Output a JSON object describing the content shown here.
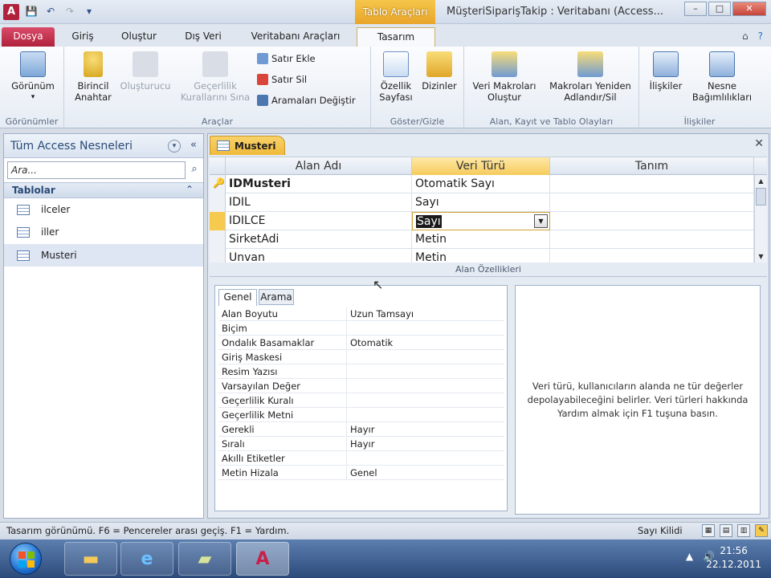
{
  "window": {
    "app_icon": "A",
    "title": "MüşteriSiparişTakip : Veritabanı (Access...",
    "context_tab_title": "Tablo Araçları",
    "controls": [
      "–",
      "□",
      "✕"
    ]
  },
  "qat": [
    "save-icon",
    "undo-icon",
    "redo-icon",
    "customize-icon"
  ],
  "tabs": {
    "file": "Dosya",
    "items": [
      "Giriş",
      "Oluştur",
      "Dış Veri",
      "Veritabanı Araçları",
      "Tasarım"
    ],
    "active": "Tasarım"
  },
  "ribbon": {
    "groups": {
      "gorunumler": "Görünümler",
      "araclar": "Araçlar",
      "goster_gizle": "Göster/Gizle",
      "olaylar": "Alan, Kayıt ve Tablo Olayları",
      "iliskiler": "İlişkiler"
    },
    "buttons": {
      "gorunum": "Görünüm",
      "birincil_anahtar": "Birincil Anahtar",
      "olusturucu": "Oluşturucu",
      "gecerlilik": "Geçerlilik Kurallarını Sına",
      "satir_ekle": "Satır Ekle",
      "satir_sil": "Satır Sil",
      "aramalari_degistir": "Aramaları Değiştir",
      "ozellik_sayfasi": "Özellik Sayfası",
      "dizinler": "Dizinler",
      "veri_makrolari": "Veri Makroları Oluştur",
      "makrolari_yeniden": "Makroları Yeniden Adlandır/Sil",
      "iliskiler": "İlişkiler",
      "nesne_bagimliliklari": "Nesne Bağımlılıkları"
    }
  },
  "nav": {
    "title": "Tüm Access Nesneleri",
    "search_value": "Ara...",
    "group": "Tablolar",
    "items": [
      "ilceler",
      "iller",
      "Musteri"
    ],
    "selected": "Musteri"
  },
  "document": {
    "tab": "Musteri",
    "columns": [
      "Alan Adı",
      "Veri Türü",
      "Tanım"
    ],
    "rows": [
      {
        "name": "IDMusteri",
        "type": "Otomatik Sayı",
        "desc": ""
      },
      {
        "name": "IDIL",
        "type": "Sayı",
        "desc": ""
      },
      {
        "name": "IDILCE",
        "type": "Sayı",
        "desc": ""
      },
      {
        "name": "SirketAdi",
        "type": "Metin",
        "desc": ""
      },
      {
        "name": "Unvan",
        "type": "Metin",
        "desc": ""
      }
    ],
    "field_props_label": "Alan Özellikleri",
    "prop_tabs": [
      "Genel",
      "Arama"
    ],
    "properties": [
      {
        "name": "Alan Boyutu",
        "value": "Uzun Tamsayı"
      },
      {
        "name": "Biçim",
        "value": ""
      },
      {
        "name": "Ondalık Basamaklar",
        "value": "Otomatik"
      },
      {
        "name": "Giriş Maskesi",
        "value": ""
      },
      {
        "name": "Resim Yazısı",
        "value": ""
      },
      {
        "name": "Varsayılan Değer",
        "value": ""
      },
      {
        "name": "Geçerlilik Kuralı",
        "value": ""
      },
      {
        "name": "Geçerlilik Metni",
        "value": ""
      },
      {
        "name": "Gerekli",
        "value": "Hayır"
      },
      {
        "name": "Sıralı",
        "value": "Hayır"
      },
      {
        "name": "Akıllı Etiketler",
        "value": ""
      },
      {
        "name": "Metin Hizala",
        "value": "Genel"
      }
    ],
    "help_text": "Veri türü, kullanıcıların alanda ne tür değerler depolayabileceğini belirler. Veri türleri hakkında Yardım almak için F1 tuşuna basın."
  },
  "status": {
    "text": "Tasarım görünümü.  F6 = Pencereler arası geçiş.  F1 = Yardım.",
    "right": "Sayı Kilidi"
  },
  "taskbar": {
    "time": "21:56",
    "date": "22.12.2011",
    "tray": [
      "▲",
      "🔊"
    ]
  }
}
